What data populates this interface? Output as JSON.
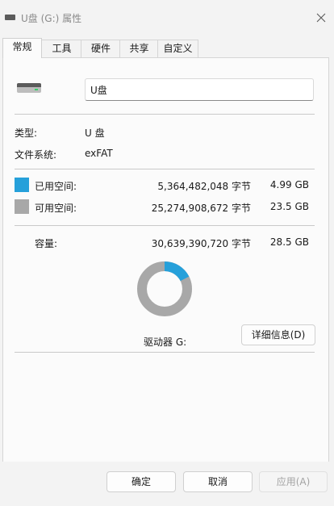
{
  "window": {
    "title": "U盘 (G:) 属性",
    "title_icon": "drive-icon",
    "close_icon": "close-icon"
  },
  "tabs": [
    {
      "label": "常规",
      "active": true
    },
    {
      "label": "工具",
      "active": false
    },
    {
      "label": "硬件",
      "active": false
    },
    {
      "label": "共享",
      "active": false
    },
    {
      "label": "自定义",
      "active": false
    }
  ],
  "general": {
    "drive_name": "U盘",
    "type_label": "类型:",
    "type_value": "U 盘",
    "fs_label": "文件系统:",
    "fs_value": "exFAT",
    "used": {
      "label": "已用空间:",
      "bytes": "5,364,482,048 字节",
      "size": "4.99 GB",
      "color": "#26a0da"
    },
    "free": {
      "label": "可用空间:",
      "bytes": "25,274,908,672 字节",
      "size": "23.5 GB",
      "color": "#a8a8a8"
    },
    "capacity": {
      "label": "容量:",
      "bytes": "30,639,390,720 字节",
      "size": "28.5 GB"
    },
    "drive_letter_label": "驱动器 G:",
    "details_button": "详细信息(D)",
    "usage": {
      "used_fraction": 0.175
    }
  },
  "footer": {
    "ok": "确定",
    "cancel": "取消",
    "apply": "应用(A)"
  }
}
